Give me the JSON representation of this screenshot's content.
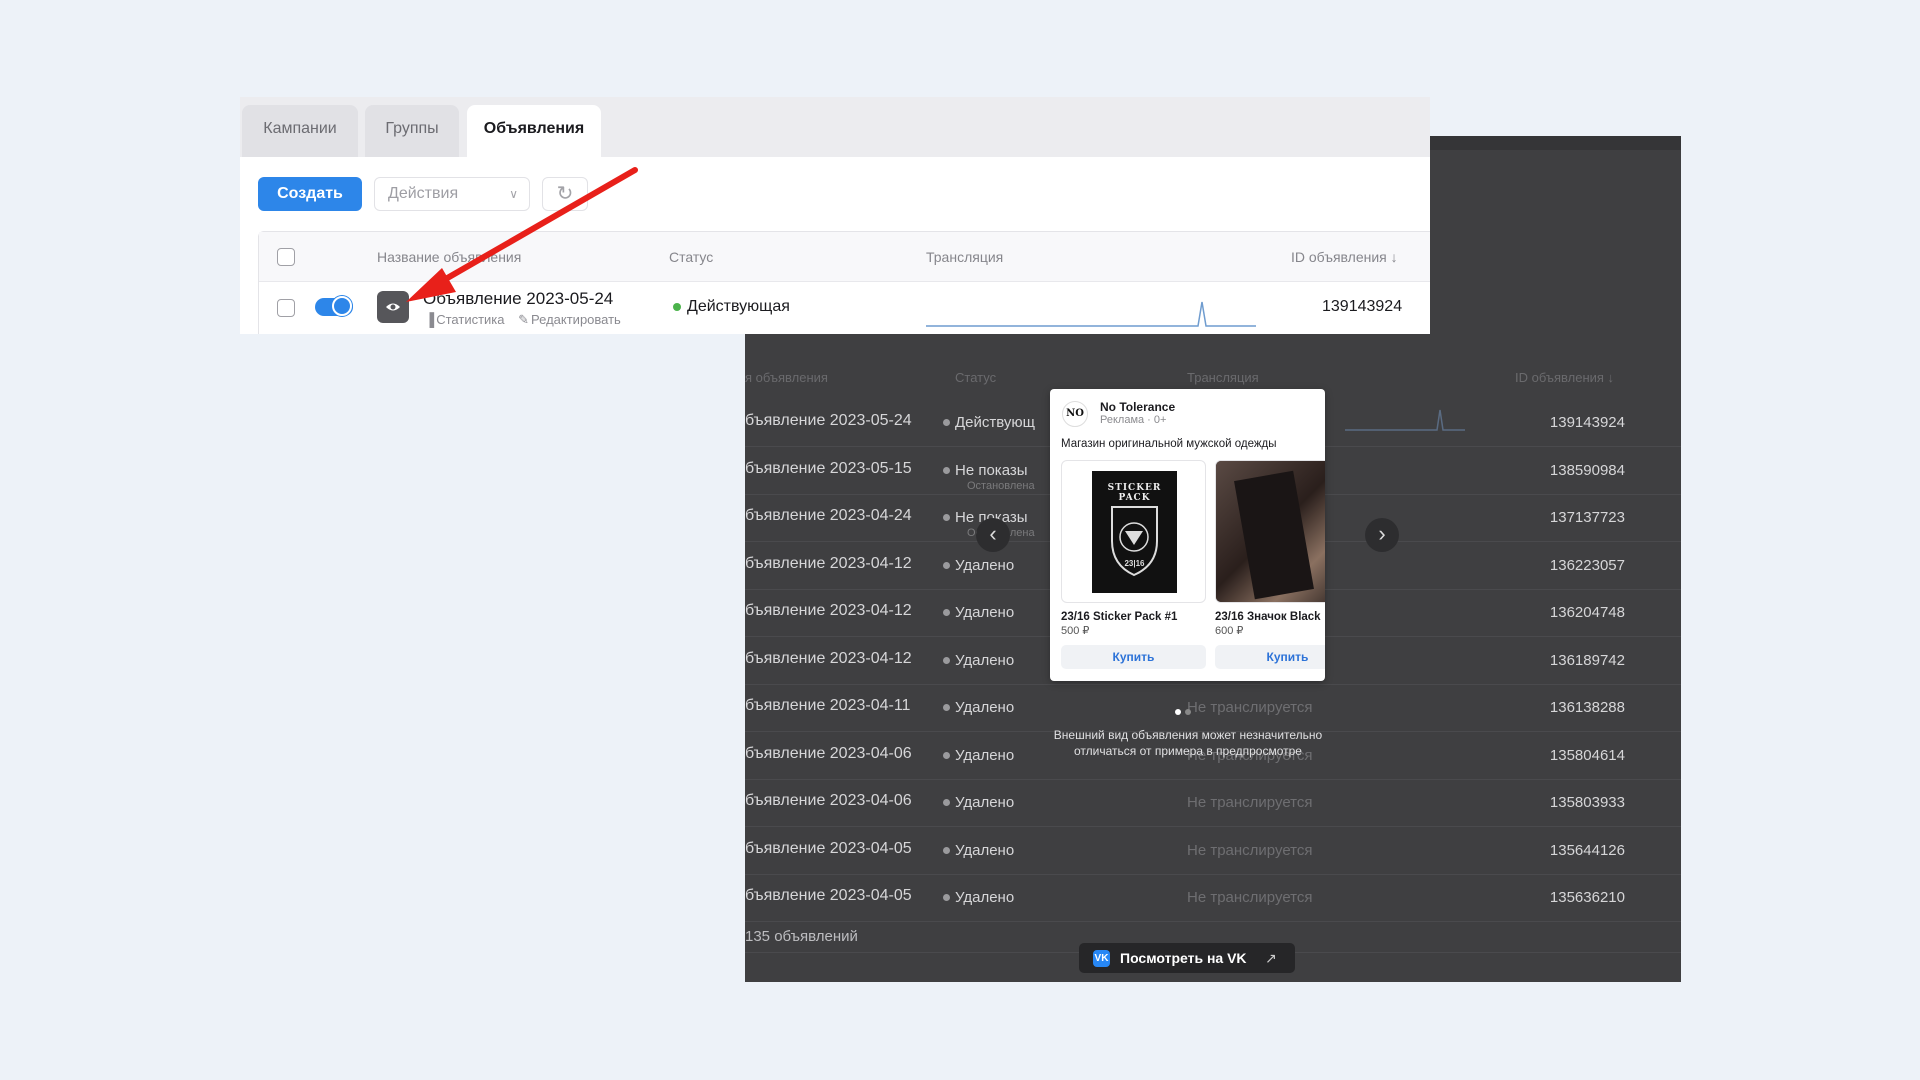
{
  "panel": {
    "tabs": [
      {
        "label": "Кампании",
        "active": false
      },
      {
        "label": "Группы",
        "active": false
      },
      {
        "label": "Объявления",
        "active": true
      }
    ],
    "toolbar": {
      "create_label": "Создать",
      "actions_placeholder": "Действия"
    },
    "table": {
      "columns": [
        "Название объявления",
        "Статус",
        "Трансляция",
        "ID объявления ↓"
      ],
      "row": {
        "name": "Объявление 2023-05-24",
        "stats_link": "Статистика",
        "edit_link": "Редактировать",
        "status": "Действующая",
        "id": "139143924"
      }
    }
  },
  "background": {
    "columns": [
      "я объявления",
      "Статус",
      "Трансляция",
      "ID объявления ↓"
    ],
    "rows": [
      {
        "name": "бъявление 2023-05-24",
        "status": "Действующ",
        "sub": "",
        "broadcast": "",
        "id": "139143924"
      },
      {
        "name": "бъявление 2023-05-15",
        "status": "Не показы",
        "sub": "Остановлена",
        "broadcast": "",
        "id": "138590984"
      },
      {
        "name": "бъявление 2023-04-24",
        "status": "Не показы",
        "sub": "Остановлена",
        "broadcast": "",
        "id": "137137723"
      },
      {
        "name": "бъявление 2023-04-12",
        "status": "Удалено",
        "sub": "",
        "broadcast": "",
        "id": "136223057"
      },
      {
        "name": "бъявление 2023-04-12",
        "status": "Удалено",
        "sub": "",
        "broadcast": "",
        "id": "136204748"
      },
      {
        "name": "бъявление 2023-04-12",
        "status": "Удалено",
        "sub": "",
        "broadcast": "",
        "id": "136189742"
      },
      {
        "name": "бъявление 2023-04-11",
        "status": "Удалено",
        "sub": "",
        "broadcast": "Не транслируется",
        "id": "136138288"
      },
      {
        "name": "бъявление 2023-04-06",
        "status": "Удалено",
        "sub": "",
        "broadcast": "Не транслируется",
        "id": "135804614"
      },
      {
        "name": "бъявление 2023-04-06",
        "status": "Удалено",
        "sub": "",
        "broadcast": "Не транслируется",
        "id": "135803933"
      },
      {
        "name": "бъявление 2023-04-05",
        "status": "Удалено",
        "sub": "",
        "broadcast": "Не транслируется",
        "id": "135644126"
      },
      {
        "name": "бъявление 2023-04-05",
        "status": "Удалено",
        "sub": "",
        "broadcast": "Не транслируется",
        "id": "135636210"
      }
    ],
    "count": "135 объявлений"
  },
  "preview": {
    "logo_text": "NO",
    "brand": "No Tolerance",
    "meta": "Реклама · 0+",
    "description": "Магазин оригинальной мужской одежды",
    "products": [
      {
        "name": "23/16 Sticker Pack #1",
        "price": "500 ₽",
        "buy": "Купить",
        "cover_text": "STICKER PACK",
        "cover_sub": "23|16"
      },
      {
        "name": "23/16 Значок Black",
        "price": "600 ₽",
        "buy": "Купить"
      }
    ],
    "note": "Внешний вид объявления может незначительно отличаться от примера в предпросмотре",
    "view_on_vk": "Посмотреть на VK",
    "vk_logo": "VK",
    "external_icon": "↗"
  },
  "colors": {
    "accent": "#2d86e9",
    "arrow": "#e8201a",
    "status_active": "#4bb34b"
  }
}
